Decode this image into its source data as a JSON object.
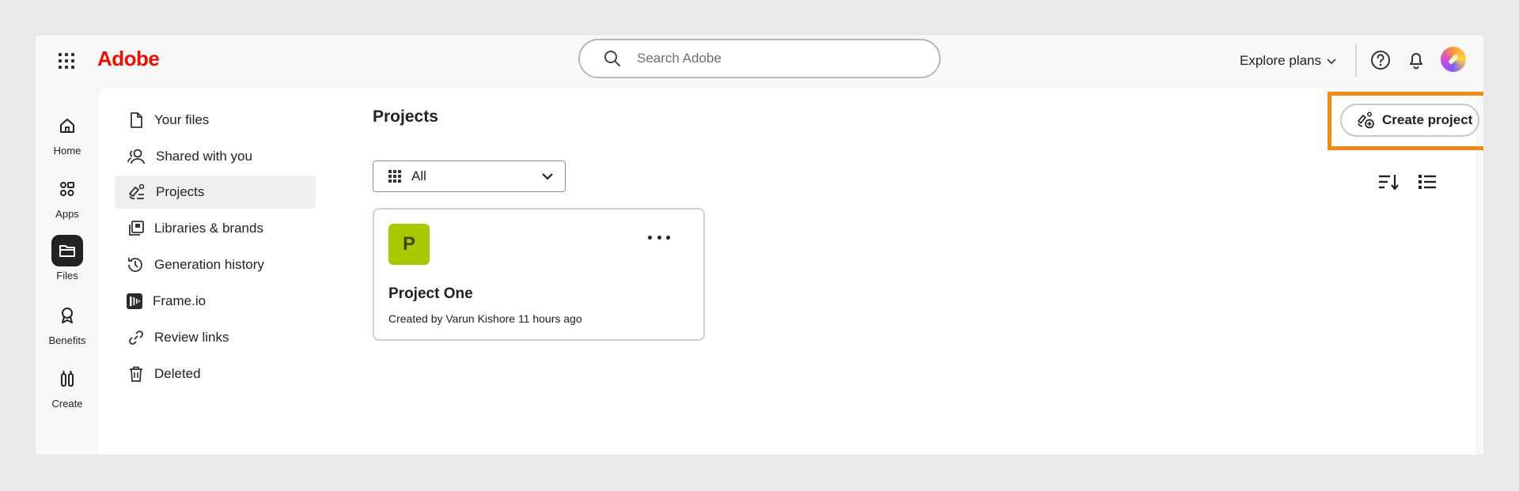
{
  "header": {
    "logo": "Adobe",
    "search_placeholder": "Search Adobe",
    "explore_label": "Explore plans"
  },
  "rail": {
    "items": [
      {
        "label": "Home",
        "icon": "home-icon"
      },
      {
        "label": "Apps",
        "icon": "apps-icon"
      },
      {
        "label": "Files",
        "icon": "folder-icon",
        "active": true
      },
      {
        "label": "Benefits",
        "icon": "award-icon"
      },
      {
        "label": "Create",
        "icon": "create-icon"
      }
    ]
  },
  "sidebar": {
    "items": [
      {
        "label": "Your files",
        "icon": "file-icon"
      },
      {
        "label": "Shared with you",
        "icon": "shared-icon"
      },
      {
        "label": "Projects",
        "icon": "projects-icon",
        "active": true
      },
      {
        "label": "Libraries & brands",
        "icon": "libraries-icon"
      },
      {
        "label": "Generation history",
        "icon": "history-icon"
      },
      {
        "label": "Frame.io",
        "icon": "frameio-icon"
      },
      {
        "label": "Review links",
        "icon": "link-icon"
      },
      {
        "label": "Deleted",
        "icon": "trash-icon"
      }
    ]
  },
  "main": {
    "title": "Projects",
    "filter_label": "All",
    "create_label": "Create project",
    "projects": [
      {
        "initial": "P",
        "name": "Project One",
        "meta": "Created by Varun Kishore 11 hours ago",
        "color": "#a8c800"
      }
    ]
  },
  "colors": {
    "brand": "#eb1000",
    "highlight": "#f08a15",
    "active_rail": "#222222"
  }
}
